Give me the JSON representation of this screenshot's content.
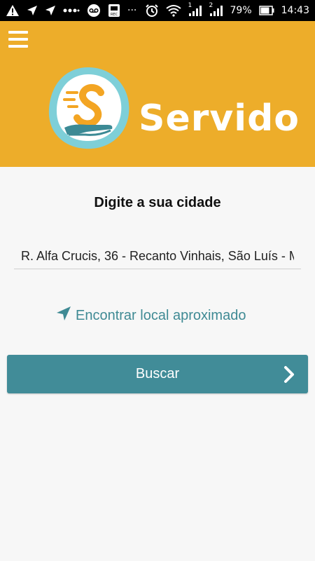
{
  "status_bar": {
    "battery_percent": "79%",
    "time": "14:43",
    "sim1": "1",
    "sim2": "2",
    "dots": "···"
  },
  "header": {
    "brand_name": "Servido",
    "brand_color": "#EDAD2A"
  },
  "main": {
    "title": "Digite a sua cidade",
    "address_value": "R. Alfa Crucis, 36 - Recanto Vinhais, São Luís - M",
    "locate_label": "Encontrar local aproximado",
    "search_label": "Buscar",
    "accent_color": "#418C98"
  },
  "icons": {
    "menu": "hamburger-menu-icon",
    "locate": "navigation-arrow-icon",
    "search_chevron": "chevron-right-icon"
  }
}
